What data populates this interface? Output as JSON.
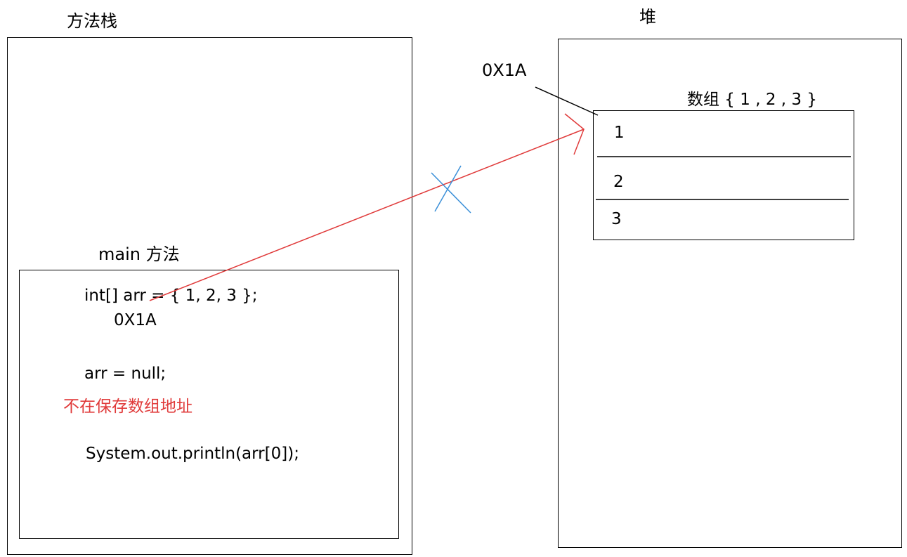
{
  "stack": {
    "title": "方法栈",
    "frame_title": "main 方法",
    "code": {
      "line1": "int[] arr = { 1, 2, 3 };",
      "address": "0X1A",
      "line2": "arr = null;",
      "note": "不在保存数组地址",
      "line3": "System.out.println(arr[0]);"
    }
  },
  "heap": {
    "title": "堆",
    "address": "0X1A",
    "array_label": "数组 { 1 , 2 , 3 }",
    "cells": [
      "1",
      "2",
      "3"
    ]
  },
  "colors": {
    "reference_arrow": "#e03a3a",
    "note_text": "#e03a3a",
    "cross_mark": "#3a8fd8",
    "outline": "#000000"
  }
}
